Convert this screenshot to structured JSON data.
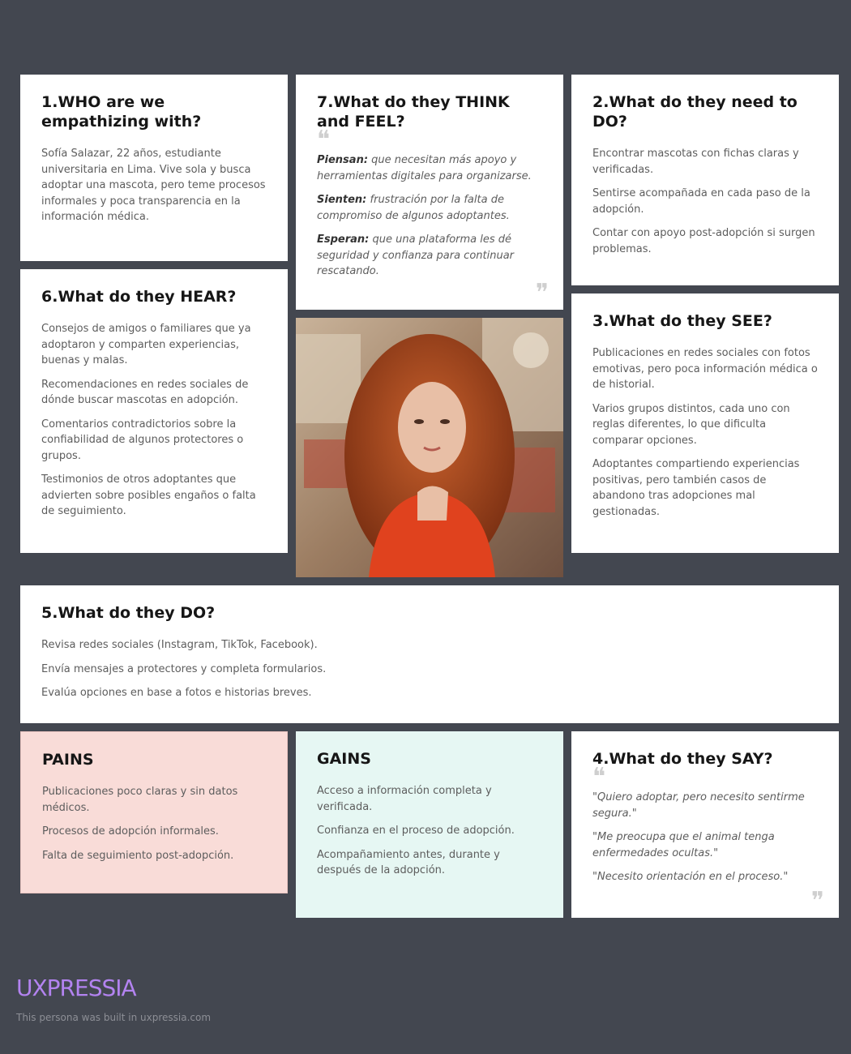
{
  "who": {
    "title": "1.WHO are we empathizing with?",
    "text": "Sofía Salazar, 22 años, estudiante universitaria en Lima. Vive sola y busca adoptar una mascota, pero teme procesos informales y poca transparencia en la información médica."
  },
  "think": {
    "title": "7.What do they THINK and FEEL?",
    "items": [
      {
        "label": "Piensan:",
        "text": " que necesitan más apoyo y herramientas digitales para organizarse."
      },
      {
        "label": "Sienten:",
        "text": " frustración por la falta de compromiso de algunos adoptantes."
      },
      {
        "label": "Esperan:",
        "text": " que una plataforma les dé seguridad y confianza para continuar rescatando."
      }
    ]
  },
  "need": {
    "title": "2.What do they need to DO?",
    "items": [
      "Encontrar mascotas con fichas claras y verificadas.",
      "Sentirse acompañada en cada paso de la adopción.",
      "Contar con apoyo post-adopción si surgen problemas."
    ]
  },
  "hear": {
    "title": "6.What do they HEAR?",
    "items": [
      "Consejos de amigos o familiares que ya adoptaron y comparten experiencias, buenas y malas.",
      "Recomendaciones en redes sociales de dónde buscar mascotas en adopción.",
      "Comentarios contradictorios sobre la confiabilidad de algunos protectores o grupos.",
      "Testimonios de otros adoptantes que advierten sobre posibles engaños o falta de seguimiento."
    ]
  },
  "see": {
    "title": "3.What do they SEE?",
    "items": [
      "Publicaciones en redes sociales con fotos emotivas, pero poca información médica o de historial.",
      "Varios grupos distintos, cada uno con reglas diferentes, lo que dificulta comparar opciones.",
      "Adoptantes compartiendo experiencias positivas, pero también casos de abandono tras adopciones mal gestionadas."
    ]
  },
  "do": {
    "title": "5.What do they DO?",
    "items": [
      "Revisa redes sociales (Instagram, TikTok, Facebook).",
      "Envía mensajes a protectores y completa formularios.",
      "Evalúa opciones en base a fotos e historias breves."
    ]
  },
  "pains": {
    "title": "PAINS",
    "items": [
      "Publicaciones poco claras y sin datos médicos.",
      "Procesos de adopción informales.",
      "Falta de seguimiento post-adopción."
    ]
  },
  "gains": {
    "title": "GAINS",
    "items": [
      "Acceso a información completa y verificada.",
      "Confianza en el proceso de adopción.",
      "Acompañamiento antes, durante y después de la adopción."
    ]
  },
  "say": {
    "title": "4.What do they SAY?",
    "items": [
      "\"Quiero adoptar, pero necesito sentirme segura.\"",
      "\"Me preocupa que el animal tenga enfermedades ocultas.\"",
      "\"Necesito orientación en el proceso.\""
    ]
  },
  "quotes": {
    "open": "❝",
    "close": "❞"
  },
  "footer": {
    "brand": "UXPRESSIA",
    "note": "This persona was built in uxpressia.com"
  },
  "colors": {
    "background": "#434750",
    "pains_bg": "#f9dcd8",
    "gains_bg": "#e6f7f3",
    "brand": "#b383f0"
  }
}
